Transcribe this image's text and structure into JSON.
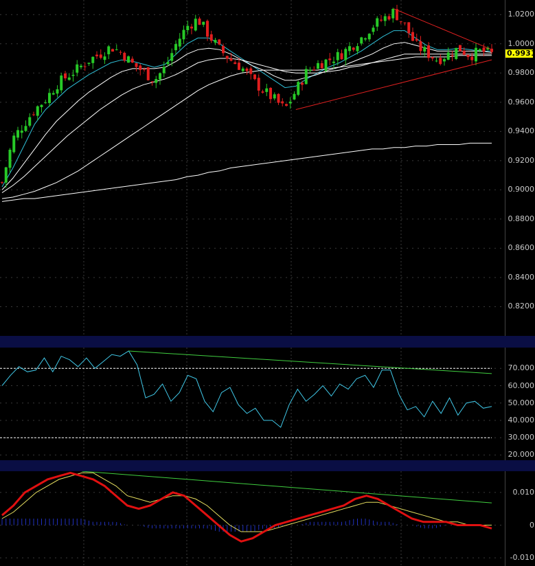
{
  "colors": {
    "background": "#000000",
    "pane_separator": "#0a0e44",
    "bull_candle": "#27c927",
    "bear_candle": "#e01e1e",
    "grid": "#3a3a3a",
    "ma_white": "#ffffff",
    "ma_cyan": "#30c0d8",
    "trendline_red": "#e02020",
    "trendline_green": "#40d040",
    "rsi_line": "#40c8e8",
    "macd_line": "#e01010",
    "macd_signal": "#e8e060",
    "macd_histogram": "#2030c0",
    "last_price_tag": "#ffff00"
  },
  "last_price_label": "0.9931",
  "chart_data": [
    {
      "type": "candlestick",
      "pane": "price",
      "ylim": [
        0.8,
        1.03
      ],
      "ytick_labels": [
        "1.0200",
        "1.0000",
        "0.9800",
        "0.9600",
        "0.9400",
        "0.9200",
        "0.9000",
        "0.8800",
        "0.8600",
        "0.8400",
        "0.8200"
      ],
      "yticks": [
        1.02,
        1.0,
        0.98,
        0.96,
        0.94,
        0.92,
        0.9,
        0.88,
        0.86,
        0.84,
        0.82
      ],
      "grid": true,
      "last_price": 0.9931,
      "close_path": [
        0.905,
        0.935,
        0.945,
        0.955,
        0.962,
        0.972,
        0.978,
        0.983,
        0.989,
        0.993,
        0.998,
        0.994,
        0.986,
        0.981,
        0.975,
        0.984,
        1.0,
        1.012,
        1.017,
        1.006,
        0.996,
        0.989,
        0.984,
        0.975,
        0.968,
        0.962,
        0.955,
        0.968,
        0.981,
        0.986,
        0.989,
        0.992,
        0.998,
        1.004,
        1.012,
        1.017,
        1.022,
        1.013,
        0.999,
        0.994,
        0.989,
        0.993,
        0.997,
        0.992,
        0.995,
        0.993
      ],
      "moving_averages": [
        {
          "color": "cyan",
          "values": [
            0.902,
            0.915,
            0.93,
            0.945,
            0.955,
            0.962,
            0.969,
            0.974,
            0.979,
            0.983,
            0.987,
            0.989,
            0.988,
            0.986,
            0.984,
            0.986,
            0.993,
            1.0,
            1.004,
            1.004,
            1.0,
            0.995,
            0.99,
            0.985,
            0.98,
            0.975,
            0.97,
            0.971,
            0.976,
            0.98,
            0.984,
            0.987,
            0.991,
            0.995,
            1.0,
            1.005,
            1.009,
            1.009,
            1.004,
            0.999,
            0.996,
            0.996,
            0.997,
            0.996,
            0.995,
            0.995
          ]
        },
        {
          "color": "white",
          "values": [
            0.9,
            0.908,
            0.918,
            0.928,
            0.938,
            0.947,
            0.954,
            0.961,
            0.967,
            0.972,
            0.977,
            0.981,
            0.983,
            0.983,
            0.983,
            0.984,
            0.988,
            0.993,
            0.996,
            0.997,
            0.996,
            0.993,
            0.989,
            0.985,
            0.982,
            0.978,
            0.975,
            0.975,
            0.977,
            0.979,
            0.982,
            0.984,
            0.987,
            0.99,
            0.993,
            0.997,
            1.0,
            1.001,
            0.999,
            0.997,
            0.995,
            0.995,
            0.995,
            0.995,
            0.995,
            0.994
          ]
        },
        {
          "color": "white",
          "values": [
            0.898,
            0.903,
            0.909,
            0.916,
            0.923,
            0.93,
            0.937,
            0.943,
            0.949,
            0.955,
            0.96,
            0.965,
            0.969,
            0.972,
            0.974,
            0.976,
            0.979,
            0.983,
            0.987,
            0.989,
            0.99,
            0.99,
            0.989,
            0.987,
            0.985,
            0.983,
            0.981,
            0.98,
            0.98,
            0.98,
            0.981,
            0.982,
            0.984,
            0.985,
            0.987,
            0.989,
            0.991,
            0.993,
            0.993,
            0.993,
            0.993,
            0.993,
            0.993,
            0.993,
            0.993,
            0.993
          ]
        },
        {
          "color": "white",
          "values": [
            0.894,
            0.895,
            0.897,
            0.899,
            0.902,
            0.905,
            0.909,
            0.913,
            0.918,
            0.923,
            0.928,
            0.933,
            0.938,
            0.943,
            0.948,
            0.953,
            0.958,
            0.963,
            0.968,
            0.972,
            0.975,
            0.978,
            0.98,
            0.981,
            0.982,
            0.982,
            0.982,
            0.982,
            0.982,
            0.982,
            0.983,
            0.984,
            0.985,
            0.986,
            0.987,
            0.988,
            0.989,
            0.99,
            0.991,
            0.991,
            0.991,
            0.991,
            0.992,
            0.992,
            0.992,
            0.992
          ]
        },
        {
          "color": "white",
          "values": [
            0.892,
            0.893,
            0.894,
            0.894,
            0.895,
            0.896,
            0.897,
            0.898,
            0.899,
            0.9,
            0.901,
            0.902,
            0.903,
            0.904,
            0.905,
            0.906,
            0.907,
            0.909,
            0.91,
            0.912,
            0.913,
            0.915,
            0.916,
            0.917,
            0.918,
            0.919,
            0.92,
            0.921,
            0.922,
            0.923,
            0.924,
            0.925,
            0.926,
            0.927,
            0.928,
            0.928,
            0.929,
            0.929,
            0.93,
            0.93,
            0.931,
            0.931,
            0.931,
            0.932,
            0.932,
            0.932
          ]
        }
      ],
      "trendlines": [
        {
          "color": "red",
          "from": [
            27,
            0.955
          ],
          "to": [
            45,
            0.989
          ]
        },
        {
          "color": "red",
          "from": [
            36,
            1.024
          ],
          "to": [
            45,
            0.996
          ]
        }
      ]
    },
    {
      "type": "line",
      "pane": "rsi",
      "ylim": [
        17,
        82
      ],
      "ytick_labels": [
        "70.000",
        "60.000",
        "50.000",
        "40.000",
        "30.000",
        "20.000"
      ],
      "yticks": [
        70,
        60,
        50,
        40,
        30,
        20
      ],
      "reference_lines": [
        70,
        30
      ],
      "values": [
        60,
        66,
        71,
        68,
        69,
        76,
        68,
        77,
        75,
        71,
        76,
        70,
        74,
        78,
        77,
        80,
        72,
        53,
        55,
        61,
        51,
        56,
        66,
        64,
        51,
        45,
        56,
        59,
        49,
        44,
        47,
        40,
        40,
        36,
        49,
        58,
        51,
        55,
        60,
        54,
        61,
        58,
        64,
        66,
        59,
        69,
        69,
        55,
        46,
        48,
        42,
        51,
        44,
        53,
        43,
        50,
        51,
        47,
        48
      ],
      "trendlines": [
        {
          "color": "green",
          "from": [
            15,
            80
          ],
          "to": [
            58,
            67
          ]
        }
      ]
    },
    {
      "type": "line",
      "pane": "macd",
      "ylim": [
        -0.0125,
        0.0165
      ],
      "ytick_labels": [
        "0.010",
        "0",
        "-0.010"
      ],
      "yticks": [
        0.01,
        0,
        -0.01
      ],
      "series": [
        {
          "role": "macd",
          "values": [
            0.003,
            0.006,
            0.01,
            0.012,
            0.014,
            0.015,
            0.016,
            0.015,
            0.014,
            0.012,
            0.009,
            0.006,
            0.005,
            0.006,
            0.008,
            0.01,
            0.009,
            0.006,
            0.003,
            0.0,
            -0.003,
            -0.005,
            -0.004,
            -0.002,
            0.0,
            0.001,
            0.002,
            0.003,
            0.004,
            0.005,
            0.006,
            0.008,
            0.009,
            0.008,
            0.006,
            0.004,
            0.002,
            0.001,
            0.001,
            0.001,
            0.0,
            0.0,
            0.0,
            -0.001
          ]
        },
        {
          "role": "signal",
          "values": [
            0.002,
            0.004,
            0.007,
            0.01,
            0.012,
            0.014,
            0.015,
            0.016,
            0.016,
            0.014,
            0.012,
            0.009,
            0.008,
            0.007,
            0.008,
            0.009,
            0.009,
            0.008,
            0.006,
            0.003,
            0.0,
            -0.002,
            -0.002,
            -0.002,
            -0.001,
            0.0,
            0.001,
            0.002,
            0.003,
            0.004,
            0.005,
            0.006,
            0.007,
            0.007,
            0.006,
            0.005,
            0.004,
            0.003,
            0.002,
            0.001,
            0.001,
            0.0,
            0.0,
            0.0
          ]
        },
        {
          "role": "histogram",
          "values": [
            0.002,
            0.002,
            0.002,
            0.002,
            0.002,
            0.002,
            0.002,
            0.002,
            0.001,
            0.001,
            0.001,
            0.0,
            0.0,
            -0.001,
            -0.001,
            -0.001,
            -0.001,
            -0.001,
            -0.001,
            -0.002,
            -0.002,
            -0.002,
            -0.002,
            -0.001,
            -0.001,
            0.0,
            0.0,
            0.001,
            0.001,
            0.001,
            0.001,
            0.002,
            0.002,
            0.001,
            0.001,
            0.0,
            0.0,
            -0.001,
            -0.001,
            0.0,
            0.0,
            0.0,
            0.0,
            0.0
          ]
        }
      ],
      "trendlines": [
        {
          "color": "green",
          "from": [
            7,
            0.0165
          ],
          "to": [
            43,
            0.0068
          ]
        }
      ]
    }
  ]
}
